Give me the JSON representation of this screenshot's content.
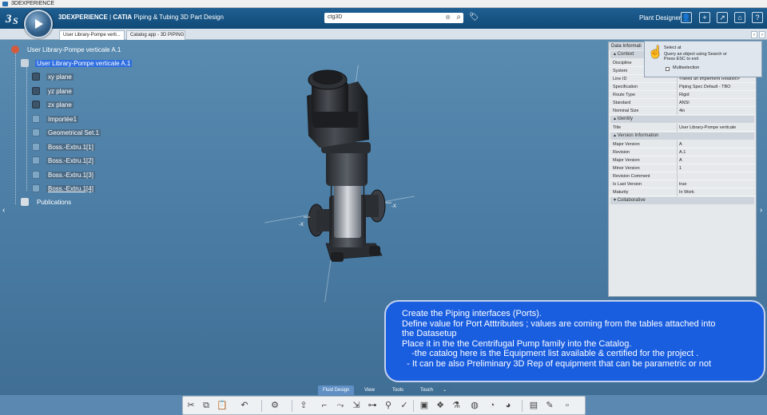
{
  "window": {
    "title": "3DEXPERIENCE"
  },
  "header": {
    "brand": "3DEXPERIENCE",
    "separator": " | ",
    "product": "CATIA",
    "app_name": " Piping & Tubing 3D Part Design",
    "search_value": "ctg3D",
    "user": "Plant Designer"
  },
  "tabs": [
    {
      "label": "User Library-Pompe verti...",
      "active": true
    },
    {
      "label": "Catalog app - 3D PIPING",
      "active": false
    }
  ],
  "tree": {
    "root": "User Library-Pompe verticale A.1",
    "part": "User Library-Pompe verticale A.1",
    "items": [
      "xy plane",
      "yz plane",
      "zx plane",
      "Importée1",
      "Geometrical Set.1",
      "Boss.-Extru.1[1]",
      "Boss.-Extru.1[2]",
      "Boss.-Extru.1[3]",
      "Boss.-Extru.1[4]"
    ],
    "publications": "Publications"
  },
  "panel": {
    "title": "Data Informati",
    "context_header": "Context",
    "context_rows": [
      {
        "key": "Discipline",
        "value": ""
      },
      {
        "key": "System",
        "value": ""
      },
      {
        "key": "Line ID",
        "value": "<Need an Implement Relation>"
      },
      {
        "key": "Specification",
        "value": "Piping Spec Default - TBO"
      },
      {
        "key": "Route Type",
        "value": "Rigid"
      },
      {
        "key": "Standard",
        "value": "ANSI"
      },
      {
        "key": "Nominal Size",
        "value": "4in"
      }
    ],
    "identity_header": "Identity",
    "identity_rows": [
      {
        "key": "Title",
        "value": "User Library-Pompe verticale"
      }
    ],
    "version_header": "Version Information",
    "version_rows": [
      {
        "key": "Major Version",
        "value": "A"
      },
      {
        "key": "Revision",
        "value": "A.1"
      },
      {
        "key": "Major Version",
        "value": "A"
      },
      {
        "key": "Minor Version",
        "value": "1"
      },
      {
        "key": "Revision Comment",
        "value": ""
      },
      {
        "key": "Is Last Version",
        "value": "true"
      },
      {
        "key": "Maturity",
        "value": "In Work"
      }
    ],
    "collab_header": "Collaborative"
  },
  "tooltip": {
    "line1": "Select at",
    "line2": "Query an object using Search or",
    "line3": "Press ESC to exit",
    "checkbox": "Multiselection"
  },
  "caption": {
    "lines": [
      "Create the Piping interfaces (Ports).",
      "Define value for Port Atttributes ; values are coming from the tables attached into",
      "the Datasetup",
      "Place it in the the Centrifugal Pump family into the Catalog.",
      "    -the catalog here is the Equipment list available & certified for the project .",
      "  - It can be also Preliminary 3D Rep of equipment that can be parametric or not"
    ]
  },
  "bottom_tabs": [
    "Fluid Design",
    "View",
    "Tools",
    "Touch"
  ],
  "toolbar_icons": [
    "cut-icon",
    "copy-icon",
    "paste-icon",
    "undo-icon",
    "settings-icon",
    "export-icon",
    "pipe-icon",
    "route-icon",
    "connect-icon",
    "port-icon",
    "valve-icon",
    "check-icon",
    "flange-icon",
    "fitting-icon",
    "spec-icon",
    "globe-icon",
    "catalog-icon",
    "edit-icon",
    "more-icon"
  ]
}
